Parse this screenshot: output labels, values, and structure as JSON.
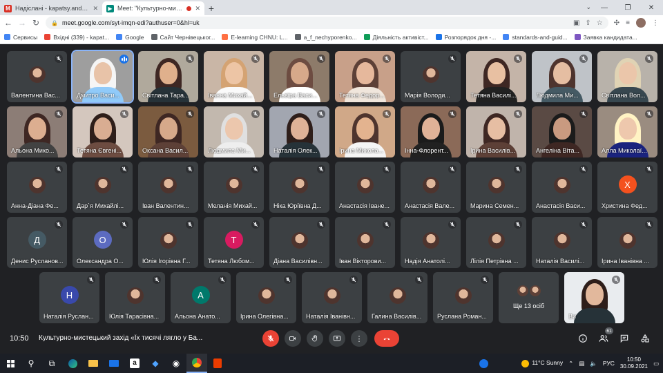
{
  "browser": {
    "tabs": [
      {
        "title": "Надіслані - kapatsy.andriy@chnu.edu.ua",
        "icon": "gmail-icon",
        "color": "#d93025",
        "glyph": "M",
        "active": false
      },
      {
        "title": "Meet: \"Культурно-мистецький захід\"",
        "icon": "meet-icon",
        "color": "#00897b",
        "glyph": "▶",
        "active": true,
        "recording": true
      }
    ],
    "new_tab": "+",
    "url": "meet.google.com/syt-imqn-edi?authuser=0&hl=uk",
    "bookmarks": [
      {
        "label": "Сервисы",
        "color": "#4285f4"
      },
      {
        "label": "Вхідні (339) - kapat...",
        "color": "#ea4335"
      },
      {
        "label": "Google",
        "color": "#4285f4"
      },
      {
        "label": "Сайт Чернівецьког...",
        "color": "#5f6368"
      },
      {
        "label": "E-learning CHNU: L...",
        "color": "#ff7043"
      },
      {
        "label": "a_f_nechyporenko...",
        "color": "#5f6368"
      },
      {
        "label": "Діяльність активіст...",
        "color": "#0f9d58"
      },
      {
        "label": "Розпорядок дня -...",
        "color": "#1a73e8"
      },
      {
        "label": "standards-and-guid...",
        "color": "#4285f4"
      },
      {
        "label": "Заявка кандидата...",
        "color": "#7e57c2"
      }
    ]
  },
  "participants": [
    {
      "name": "Валентина Вас...",
      "kind": "photo"
    },
    {
      "name": "Дмитро Васи...",
      "kind": "cam",
      "bg": "#9e9e9e",
      "hair": "#f5f5f5",
      "skin": "#e8c3a8",
      "body": "#90caf9",
      "speaking": true
    },
    {
      "name": "Світлана Тара...",
      "kind": "cam",
      "bg": "#b0a99c",
      "hair": "#3e2723",
      "skin": "#e0b08c",
      "body": "#263238"
    },
    {
      "name": "Іванна Михай...",
      "kind": "cam",
      "bg": "#c9b6a6",
      "hair": "#d4a373",
      "skin": "#edc5a5",
      "body": "#fafafa"
    },
    {
      "name": "Ельвіра Васи...",
      "kind": "cam",
      "bg": "#8d7b6a",
      "hair": "#6d4c41",
      "skin": "#d7a98a",
      "body": "#ffffff"
    },
    {
      "name": "Тетяна Федор...",
      "kind": "cam",
      "bg": "#c8a089",
      "hair": "#5d4037",
      "skin": "#e6b89c",
      "body": "#f0e6dc"
    },
    {
      "name": "Марія Володи...",
      "kind": "photo"
    },
    {
      "name": "Тетяна Василі...",
      "kind": "cam",
      "bg": "#c4b4a8",
      "hair": "#3e2723",
      "skin": "#e8c0a2",
      "body": "#212121"
    },
    {
      "name": "Людмила Ми...",
      "kind": "cam",
      "bg": "#bfc3c8",
      "hair": "#4e342e",
      "skin": "#e5bea2",
      "body": "#455a64"
    },
    {
      "name": "Світлана Вол...",
      "kind": "cam",
      "bg": "#b8b2aa",
      "hair": "#e0d3b4",
      "skin": "#ebc6aa",
      "body": "#37474f"
    },
    {
      "name": "Альона Мико...",
      "kind": "cam",
      "bg": "#8c7d76",
      "hair": "#3e2723",
      "skin": "#dcae90",
      "body": "#424242"
    },
    {
      "name": "Тетяна Євгені...",
      "kind": "cam",
      "bg": "#d4c7be",
      "hair": "#2e1e1a",
      "skin": "#d9ad92",
      "body": "#6d4c41"
    },
    {
      "name": "Оксана Васил...",
      "kind": "cam",
      "bg": "#7b5b3f",
      "hair": "#3e2723",
      "skin": "#d6a98a",
      "body": "#5d4037"
    },
    {
      "name": "Людмила Ми...",
      "kind": "cam",
      "bg": "#c2b8ae",
      "hair": "#e0e0e0",
      "skin": "#ecc7ad",
      "body": "#eeeeee"
    },
    {
      "name": "Наталія Олек...",
      "kind": "cam",
      "bg": "#a2a6b0",
      "hair": "#2e1e1a",
      "skin": "#deb297",
      "body": "#263238"
    },
    {
      "name": "Ірина Микола...",
      "kind": "cam",
      "bg": "#d0a888",
      "hair": "#4e342e",
      "skin": "#e3b38f",
      "body": "#f5f5f5"
    },
    {
      "name": "Інна-Флорент...",
      "kind": "cam",
      "bg": "#8b6a58",
      "hair": "#1b1b1b",
      "skin": "#e0b297",
      "body": "#212121"
    },
    {
      "name": "Ірина Василів...",
      "kind": "cam",
      "bg": "#c0b4ab",
      "hair": "#3e2723",
      "skin": "#e6bea3",
      "body": "#5d4037"
    },
    {
      "name": "Ангеліна Віта...",
      "kind": "cam",
      "bg": "#5a4a44",
      "hair": "#1b1b1b",
      "skin": "#c99a80",
      "body": "#3e2723"
    },
    {
      "name": "Алла Миколаї...",
      "kind": "cam",
      "bg": "#9a8c80",
      "hair": "#fff3c4",
      "skin": "#eec8ad",
      "body": "#1a237e"
    },
    {
      "name": "Анна-Діана Фе...",
      "kind": "photo"
    },
    {
      "name": "Дар`я Михайлі...",
      "kind": "photo"
    },
    {
      "name": "Іван Валентин...",
      "kind": "photo"
    },
    {
      "name": "Меланія Михай...",
      "kind": "photo"
    },
    {
      "name": "Ніка Юріївна Д...",
      "kind": "photo"
    },
    {
      "name": "Анастасія Іване...",
      "kind": "photo"
    },
    {
      "name": "Анастасія Вале...",
      "kind": "photo"
    },
    {
      "name": "Марина Семен...",
      "kind": "photo"
    },
    {
      "name": "Анастасія Васи...",
      "kind": "photo"
    },
    {
      "name": "Христина Фед...",
      "kind": "letter",
      "letter": "Х",
      "color": "#f4511e"
    },
    {
      "name": "Денис Русланов...",
      "kind": "letter",
      "letter": "Д",
      "color": "#455a64"
    },
    {
      "name": "Олександра О...",
      "kind": "letter",
      "letter": "О",
      "color": "#5c6bc0"
    },
    {
      "name": "Юлія Ігорівна Г...",
      "kind": "photo"
    },
    {
      "name": "Тетяна Любом...",
      "kind": "letter",
      "letter": "Т",
      "color": "#d81b60"
    },
    {
      "name": "Діана Василівн...",
      "kind": "photo"
    },
    {
      "name": "Іван Вікторови...",
      "kind": "photo"
    },
    {
      "name": "Надія Анатолі...",
      "kind": "photo"
    },
    {
      "name": "Лілія Петрівна ...",
      "kind": "photo"
    },
    {
      "name": "Наталія Василі...",
      "kind": "photo"
    },
    {
      "name": "Ірина Іванівна ...",
      "kind": "photo"
    },
    {
      "name": "Наталія Руслан...",
      "kind": "letter",
      "letter": "Н",
      "color": "#3949ab"
    },
    {
      "name": "Юлія Тарасівна...",
      "kind": "photo"
    },
    {
      "name": "Альона Анато...",
      "kind": "letter",
      "letter": "А",
      "color": "#00796b"
    },
    {
      "name": "Ірина Олегівна...",
      "kind": "photo"
    },
    {
      "name": "Наталія Іванівн...",
      "kind": "photo"
    },
    {
      "name": "Галина Василів...",
      "kind": "photo"
    },
    {
      "name": "Руслана Роман...",
      "kind": "photo"
    },
    {
      "name": "Ще 13 осіб",
      "kind": "more"
    },
    {
      "name": "Ви",
      "kind": "cam",
      "bg": "#e9ecef",
      "hair": "#2e1e1a",
      "skin": "#e2b89c",
      "body": "#263238",
      "self": true
    }
  ],
  "meeting": {
    "time": "10:50",
    "title": "Культурно-мистецький захід «Їх тисячі лягло у Ба...",
    "participant_count": "61"
  },
  "taskbar": {
    "weather": "11°C  Sunny",
    "language": "РУС",
    "time": "10:50",
    "date": "30.09.2021"
  }
}
